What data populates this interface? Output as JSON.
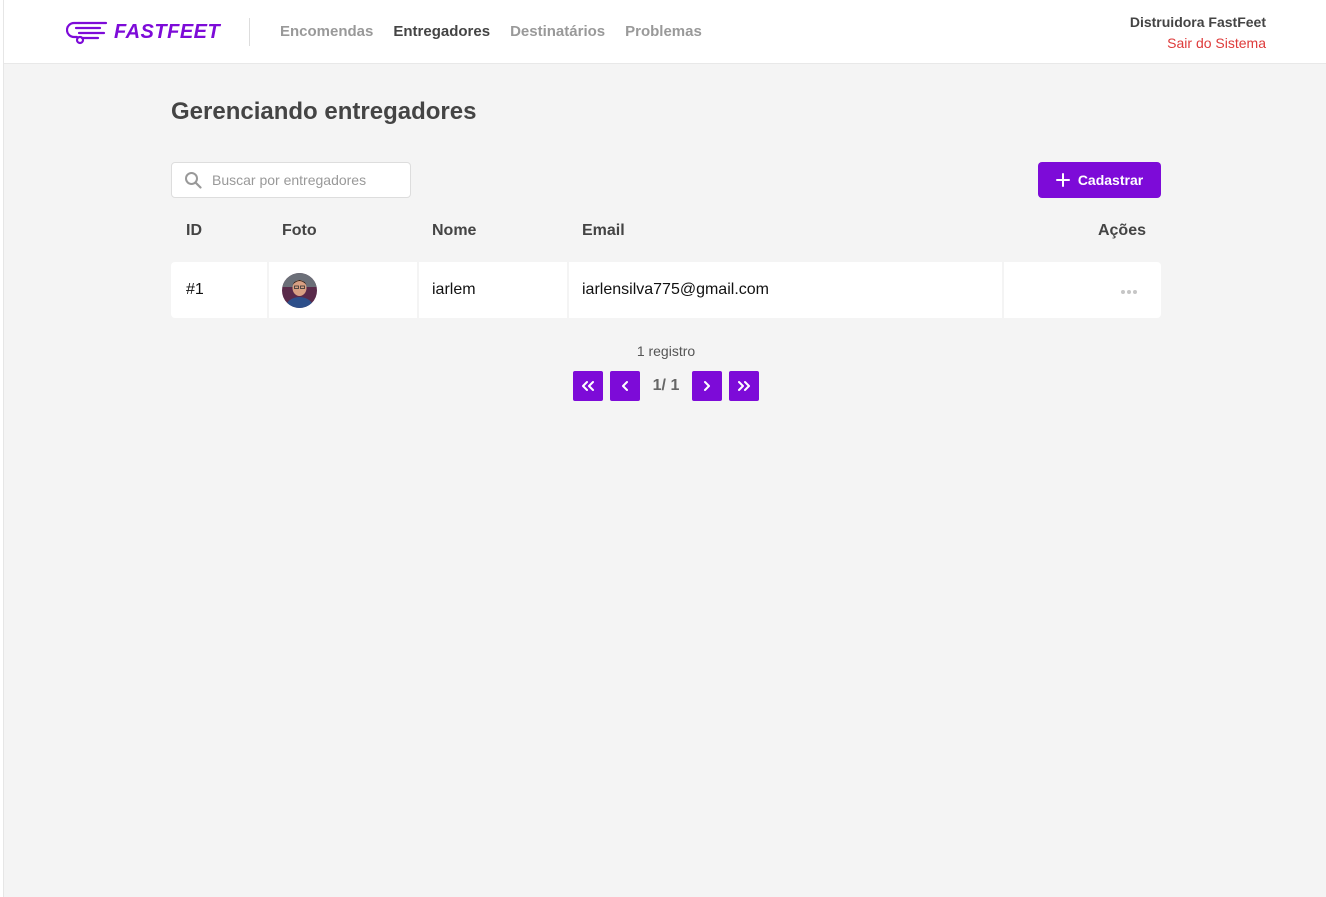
{
  "header": {
    "logo_text": "FASTFEET",
    "nav": [
      {
        "label": "Encomendas",
        "active": false
      },
      {
        "label": "Entregadores",
        "active": true
      },
      {
        "label": "Destinatários",
        "active": false
      },
      {
        "label": "Problemas",
        "active": false
      }
    ],
    "user_name": "Distruidora FastFeet",
    "logout_label": "Sair do Sistema"
  },
  "page": {
    "title": "Gerenciando entregadores",
    "search_placeholder": "Buscar por entregadores",
    "search_value": "",
    "add_button_label": "Cadastrar"
  },
  "table": {
    "columns": [
      "ID",
      "Foto",
      "Nome",
      "Email",
      "Ações"
    ],
    "rows": [
      {
        "id": "#1",
        "nome": "iarlem",
        "email": "iarlensilva775@gmail.com"
      }
    ]
  },
  "pagination": {
    "count_label": "1 registro",
    "page_label": "1/ 1"
  },
  "colors": {
    "primary": "#7d0bd8",
    "danger": "#de3b3b",
    "background": "#f4f4f4"
  }
}
